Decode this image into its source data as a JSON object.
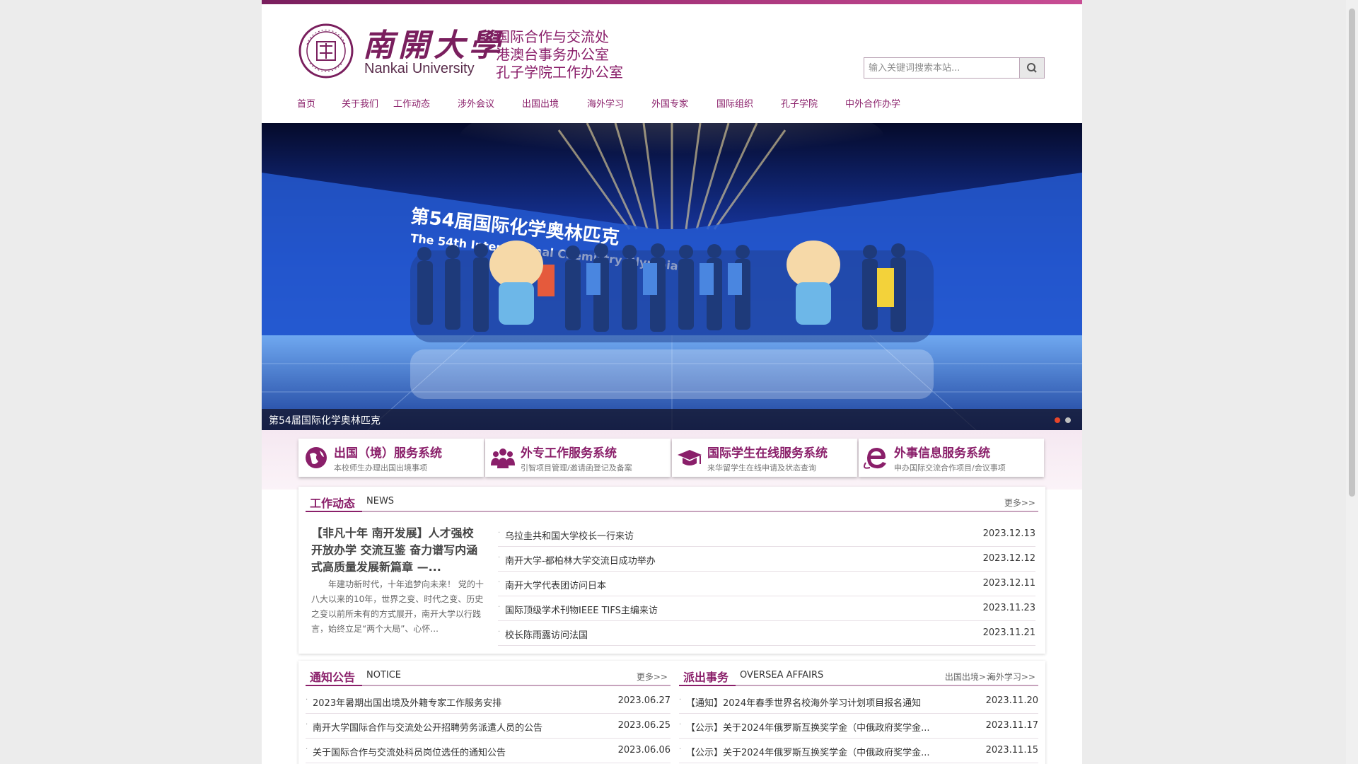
{
  "header": {
    "logo_cn": "南開大學",
    "logo_en": "Nankai University",
    "offices": [
      "国际合作与交流处",
      "港澳台事务办公室",
      "孔子学院工作办公室"
    ]
  },
  "search": {
    "placeholder": "输入关键词搜索本站..."
  },
  "nav": [
    "首页",
    "关于我们",
    "工作动态",
    "涉外会议",
    "出国出境",
    "海外学习",
    "外国专家",
    "国际组织",
    "孔子学院",
    "中外合作办学"
  ],
  "banner": {
    "caption": "第54届国际化学奥林匹克",
    "screen_text_cn": "第54届国际化学奥林匹克",
    "screen_text_en": "The 54th International Chemistry Olympiad",
    "active_slide": 1,
    "slides": 2
  },
  "services": [
    {
      "title": "出国（境）服务系统",
      "sub": "本校师生办理出国出境事项",
      "icon": "globe-icon"
    },
    {
      "title": "外专工作服务系统",
      "sub": "引智项目管理/邀请函登记及备案",
      "icon": "people-icon"
    },
    {
      "title": "国际学生在线服务系统",
      "sub": "来华留学生在线申请及状态查询",
      "icon": "graduation-cap-icon"
    },
    {
      "title": "外事信息服务系统",
      "sub": "申办国际交流合作项目/会议事项",
      "icon": "browser-e-icon"
    }
  ],
  "news": {
    "title_cn": "工作动态",
    "title_en": "NEWS",
    "more": "更多>>",
    "feature_title": "【非凡十年 南开发展】人才强校 开放办学 交流互鉴 奋力谱写内涵式高质量发展新篇章 —...",
    "feature_body": "年建功新时代，十年追梦向未来！ 党的十八大以来的10年，世界之变、时代之变、历史之变以前所未有的方式展开，南开大学以行践言，始终立足“两个大局”、心怀...",
    "items": [
      {
        "title": "乌拉圭共和国大学校长一行来访",
        "date": "2023.12.13"
      },
      {
        "title": "南开大学-都柏林大学交流日成功举办",
        "date": "2023.12.12"
      },
      {
        "title": "南开大学代表团访问日本",
        "date": "2023.12.11"
      },
      {
        "title": "国际顶级学术刊物IEEE TIFS主编来访",
        "date": "2023.11.23"
      },
      {
        "title": "校长陈雨露访问法国",
        "date": "2023.11.21"
      }
    ]
  },
  "notice": {
    "title_cn": "通知公告",
    "title_en": "NOTICE",
    "more": "更多>>",
    "items": [
      {
        "title": "2023年暑期出国出境及外籍专家工作服务安排",
        "date": "2023.06.27"
      },
      {
        "title": "南开大学国际合作与交流处公开招聘劳务派遣人员的公告",
        "date": "2023.06.25"
      },
      {
        "title": "关于国际合作与交流处科员岗位选任的通知公告",
        "date": "2023.06.06"
      }
    ]
  },
  "overseas": {
    "title_cn": "派出事务",
    "title_en": "OVERSEA AFFAIRS",
    "link1": "出国出境>>",
    "link2": "海外学习>>",
    "items": [
      {
        "title": "【通知】2024年春季世界名校海外学习计划项目报名通知",
        "date": "2023.11.20"
      },
      {
        "title": "【公示】关于2024年俄罗斯互换奖学金（中俄政府奖学金...",
        "date": "2023.11.17"
      },
      {
        "title": "【公示】关于2024年俄罗斯互换奖学金（中俄政府奖学金...",
        "date": "2023.11.15"
      }
    ]
  },
  "colors": {
    "brand": "#8a1f6a",
    "accent_bar": "#a6347a"
  }
}
